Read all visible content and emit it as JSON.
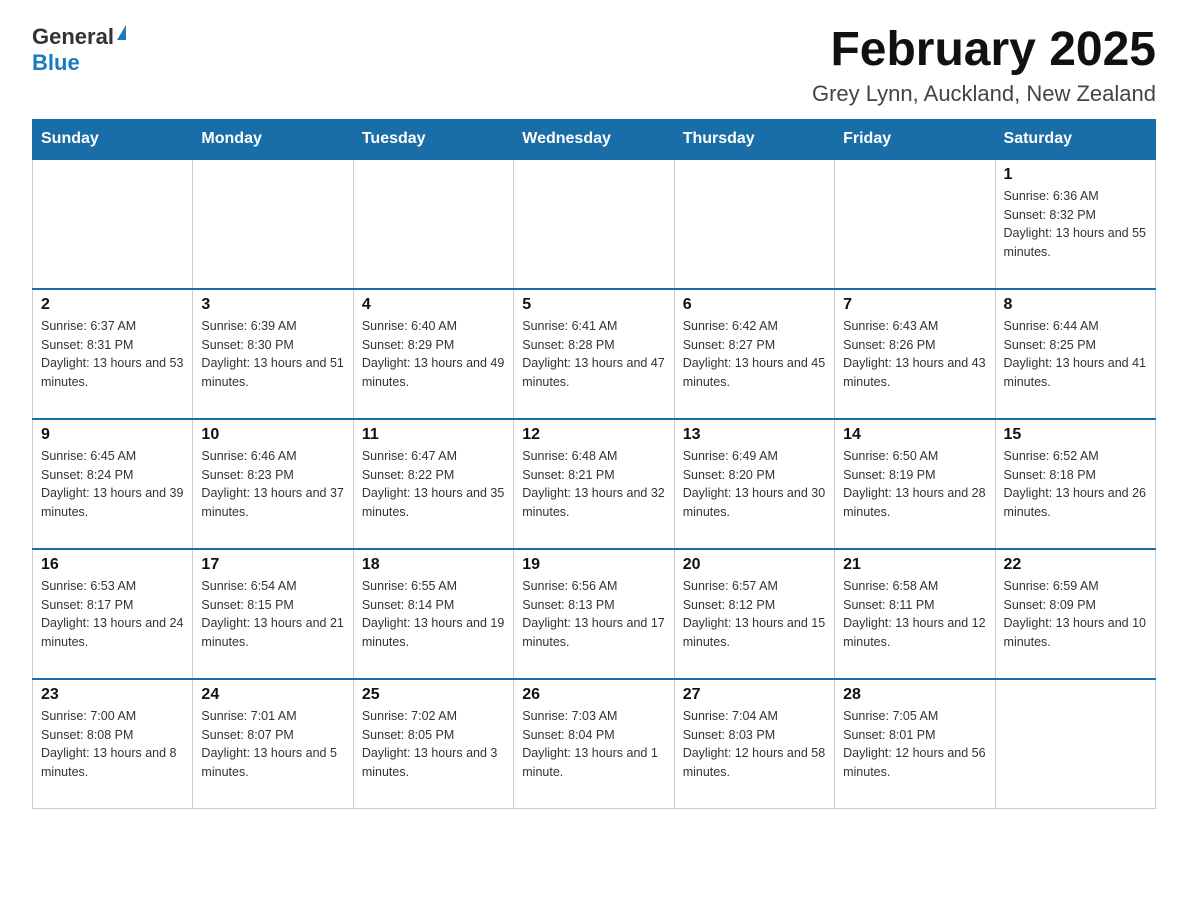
{
  "header": {
    "logo_general": "General",
    "logo_blue": "Blue",
    "title": "February 2025",
    "subtitle": "Grey Lynn, Auckland, New Zealand"
  },
  "weekdays": [
    "Sunday",
    "Monday",
    "Tuesday",
    "Wednesday",
    "Thursday",
    "Friday",
    "Saturday"
  ],
  "weeks": [
    [
      {
        "day": "",
        "info": ""
      },
      {
        "day": "",
        "info": ""
      },
      {
        "day": "",
        "info": ""
      },
      {
        "day": "",
        "info": ""
      },
      {
        "day": "",
        "info": ""
      },
      {
        "day": "",
        "info": ""
      },
      {
        "day": "1",
        "info": "Sunrise: 6:36 AM\nSunset: 8:32 PM\nDaylight: 13 hours and 55 minutes."
      }
    ],
    [
      {
        "day": "2",
        "info": "Sunrise: 6:37 AM\nSunset: 8:31 PM\nDaylight: 13 hours and 53 minutes."
      },
      {
        "day": "3",
        "info": "Sunrise: 6:39 AM\nSunset: 8:30 PM\nDaylight: 13 hours and 51 minutes."
      },
      {
        "day": "4",
        "info": "Sunrise: 6:40 AM\nSunset: 8:29 PM\nDaylight: 13 hours and 49 minutes."
      },
      {
        "day": "5",
        "info": "Sunrise: 6:41 AM\nSunset: 8:28 PM\nDaylight: 13 hours and 47 minutes."
      },
      {
        "day": "6",
        "info": "Sunrise: 6:42 AM\nSunset: 8:27 PM\nDaylight: 13 hours and 45 minutes."
      },
      {
        "day": "7",
        "info": "Sunrise: 6:43 AM\nSunset: 8:26 PM\nDaylight: 13 hours and 43 minutes."
      },
      {
        "day": "8",
        "info": "Sunrise: 6:44 AM\nSunset: 8:25 PM\nDaylight: 13 hours and 41 minutes."
      }
    ],
    [
      {
        "day": "9",
        "info": "Sunrise: 6:45 AM\nSunset: 8:24 PM\nDaylight: 13 hours and 39 minutes."
      },
      {
        "day": "10",
        "info": "Sunrise: 6:46 AM\nSunset: 8:23 PM\nDaylight: 13 hours and 37 minutes."
      },
      {
        "day": "11",
        "info": "Sunrise: 6:47 AM\nSunset: 8:22 PM\nDaylight: 13 hours and 35 minutes."
      },
      {
        "day": "12",
        "info": "Sunrise: 6:48 AM\nSunset: 8:21 PM\nDaylight: 13 hours and 32 minutes."
      },
      {
        "day": "13",
        "info": "Sunrise: 6:49 AM\nSunset: 8:20 PM\nDaylight: 13 hours and 30 minutes."
      },
      {
        "day": "14",
        "info": "Sunrise: 6:50 AM\nSunset: 8:19 PM\nDaylight: 13 hours and 28 minutes."
      },
      {
        "day": "15",
        "info": "Sunrise: 6:52 AM\nSunset: 8:18 PM\nDaylight: 13 hours and 26 minutes."
      }
    ],
    [
      {
        "day": "16",
        "info": "Sunrise: 6:53 AM\nSunset: 8:17 PM\nDaylight: 13 hours and 24 minutes."
      },
      {
        "day": "17",
        "info": "Sunrise: 6:54 AM\nSunset: 8:15 PM\nDaylight: 13 hours and 21 minutes."
      },
      {
        "day": "18",
        "info": "Sunrise: 6:55 AM\nSunset: 8:14 PM\nDaylight: 13 hours and 19 minutes."
      },
      {
        "day": "19",
        "info": "Sunrise: 6:56 AM\nSunset: 8:13 PM\nDaylight: 13 hours and 17 minutes."
      },
      {
        "day": "20",
        "info": "Sunrise: 6:57 AM\nSunset: 8:12 PM\nDaylight: 13 hours and 15 minutes."
      },
      {
        "day": "21",
        "info": "Sunrise: 6:58 AM\nSunset: 8:11 PM\nDaylight: 13 hours and 12 minutes."
      },
      {
        "day": "22",
        "info": "Sunrise: 6:59 AM\nSunset: 8:09 PM\nDaylight: 13 hours and 10 minutes."
      }
    ],
    [
      {
        "day": "23",
        "info": "Sunrise: 7:00 AM\nSunset: 8:08 PM\nDaylight: 13 hours and 8 minutes."
      },
      {
        "day": "24",
        "info": "Sunrise: 7:01 AM\nSunset: 8:07 PM\nDaylight: 13 hours and 5 minutes."
      },
      {
        "day": "25",
        "info": "Sunrise: 7:02 AM\nSunset: 8:05 PM\nDaylight: 13 hours and 3 minutes."
      },
      {
        "day": "26",
        "info": "Sunrise: 7:03 AM\nSunset: 8:04 PM\nDaylight: 13 hours and 1 minute."
      },
      {
        "day": "27",
        "info": "Sunrise: 7:04 AM\nSunset: 8:03 PM\nDaylight: 12 hours and 58 minutes."
      },
      {
        "day": "28",
        "info": "Sunrise: 7:05 AM\nSunset: 8:01 PM\nDaylight: 12 hours and 56 minutes."
      },
      {
        "day": "",
        "info": ""
      }
    ]
  ]
}
